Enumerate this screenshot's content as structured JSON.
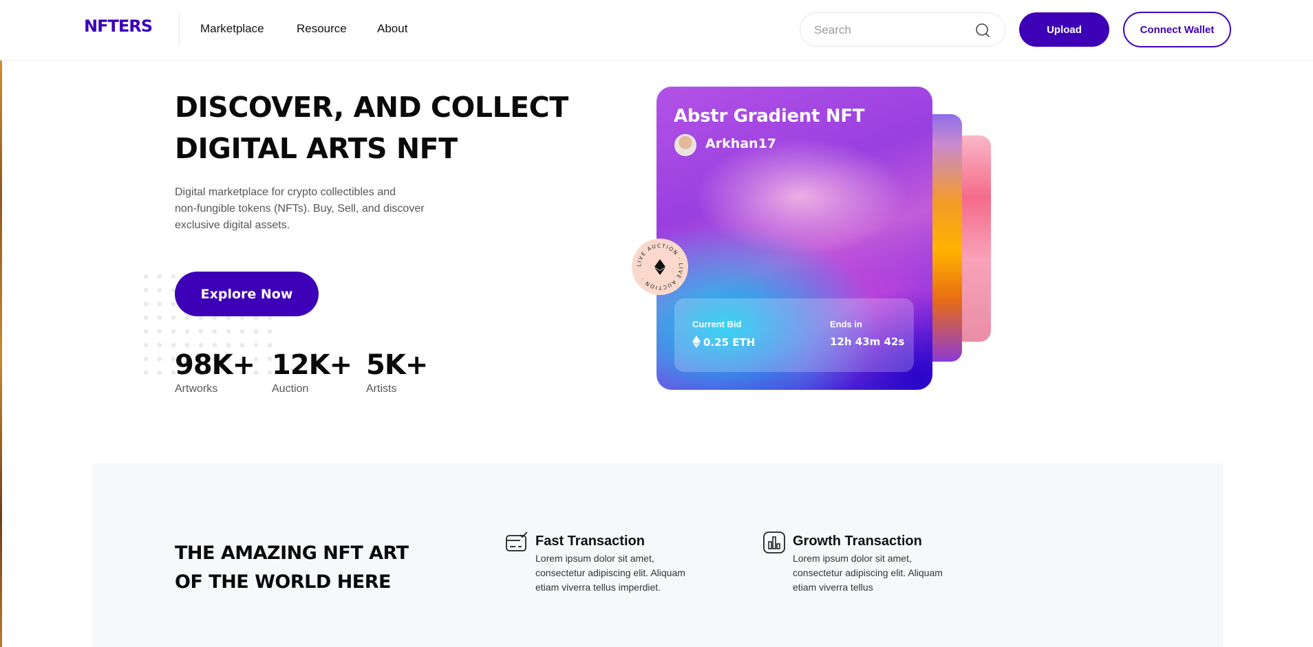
{
  "header": {
    "logo": "NFTERS",
    "nav": [
      "Marketplace",
      "Resource",
      "About"
    ],
    "search_placeholder": "Search",
    "upload_label": "Upload",
    "wallet_label": "Connect Wallet"
  },
  "hero": {
    "title_line1": "DISCOVER, AND COLLECT",
    "title_line2": "DIGITAL ARTS NFT",
    "desc_line1": "Digital marketplace for crypto collectibles and",
    "desc_line2": "non-fungible tokens (NFTs). Buy, Sell, and discover",
    "desc_line3": "exclusive digital assets.",
    "cta_label": "Explore Now",
    "stats": [
      {
        "value": "98K+",
        "label": "Artworks"
      },
      {
        "value": "12K+",
        "label": "Auction"
      },
      {
        "value": "5K+",
        "label": "Artists"
      }
    ]
  },
  "card": {
    "title": "Abstr Gradient NFT",
    "username": "Arkhan17",
    "badge_text": "LIVE AUCTION · LIVE AUCTION ·",
    "current_bid_label": "Current Bid",
    "current_bid_value": "0.25 ETH",
    "ends_label": "Ends in",
    "ends_value": "12h 43m 42s"
  },
  "features": {
    "title_line1": "THE AMAZING NFT ART",
    "title_line2": "OF THE WORLD HERE",
    "items": [
      {
        "name": "Fast Transaction",
        "icon": "card-check-icon",
        "desc": "Lorem ipsum dolor sit amet, consectetur adipiscing elit. Aliquam etiam viverra tellus imperdiet."
      },
      {
        "name": "Growth Transaction",
        "icon": "bar-chart-icon",
        "desc": "Lorem ipsum dolor sit amet, consectetur adipiscing elit. Aliquam etiam viverra tellus"
      }
    ]
  },
  "colors": {
    "accent": "#3d00b7",
    "feature_bg": "#f7f8fa",
    "badge_bg": "#fad9cc"
  }
}
